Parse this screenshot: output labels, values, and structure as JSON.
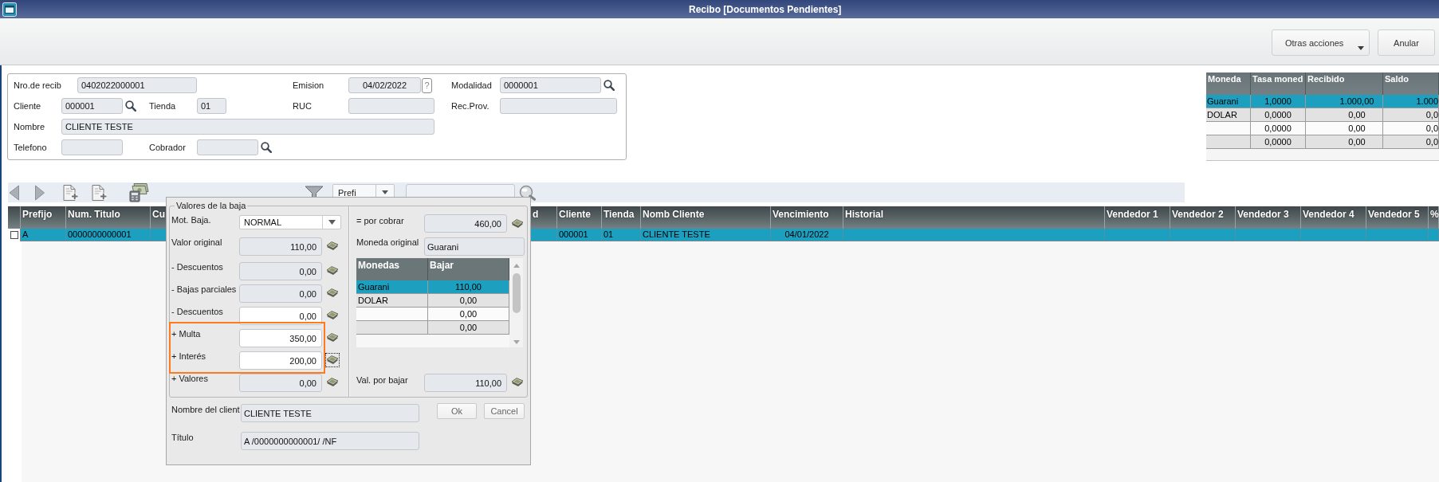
{
  "window": {
    "title": "Recibo [Documentos Pendientes]"
  },
  "toolbar": {
    "buttons": [
      {
        "label": "Otras acciones",
        "kind": "menu"
      },
      {
        "label": "Anular",
        "kind": "plain"
      }
    ]
  },
  "header_form": {
    "rows": [
      [
        {
          "label": "Nro.de recib",
          "value": "0402022000001",
          "kind": "text"
        },
        "",
        {
          "label": "Emision",
          "value": "04/02/2022",
          "kind": "date",
          "help": "?"
        },
        {
          "label": "Modalidad",
          "value": "0000001",
          "kind": "lookup"
        }
      ],
      [
        {
          "label": "Cliente",
          "value": "000001",
          "kind": "lookup"
        },
        {
          "label": "Tienda",
          "value": "01",
          "kind": "text"
        },
        {
          "label": "RUC",
          "kind": "text"
        },
        {
          "label": "Rec.Prov.",
          "kind": "text"
        }
      ],
      [
        {
          "label": "Nombre",
          "value": "CLIENTE TESTE",
          "kind": "text"
        }
      ],
      [
        {
          "label": "Telefono",
          "kind": "text"
        },
        {
          "label": "Cobrador",
          "kind": "lookup"
        }
      ]
    ]
  },
  "currency_table": {
    "columns": [
      "Moneda",
      "Tasa moned",
      "Recibido",
      "Saldo"
    ],
    "rows": [
      {
        "moneda": "Guarani",
        "tasa": "1,0000",
        "recibido": "1.000,00",
        "saldo": "1.000",
        "selected": true
      },
      {
        "moneda": "DOLAR",
        "tasa": "0,0000",
        "recibido": "0,00",
        "saldo": "0,0",
        "selected": false
      },
      {
        "tasa": "0,0000",
        "recibido": "0,00",
        "saldo": "0,0",
        "selected": false
      },
      {
        "tasa": "0,0000",
        "recibido": "0,00",
        "saldo": "0,0",
        "selected": false
      }
    ]
  },
  "grid_toolbar": {
    "filter_field": {
      "value": "Prefi"
    }
  },
  "grid": {
    "columns": [
      "Prefijo",
      "Num. Titulo",
      "Cu",
      "d",
      "Cliente",
      "Tienda",
      "Nomb Cliente",
      "Vencimiento",
      "Historial",
      "Vendedor 1",
      "Vendedor 2",
      "Vendedor 3",
      "Vendedor 4",
      "Vendedor 5",
      "%"
    ],
    "rows": [
      {
        "checked": false,
        "selected": true,
        "cells": [
          "A",
          "0000000000001",
          null,
          null,
          "000001",
          "01",
          "CLIENTE TESTE",
          "04/01/2022",
          null,
          null,
          null,
          null,
          null,
          null,
          null
        ]
      }
    ]
  },
  "dialog": {
    "group_title": "Valores de la baja",
    "left_rows": [
      {
        "label": "Mot. Baja.",
        "value": "NORMAL",
        "kind": "select"
      },
      {
        "label": "Valor original",
        "value": "110,00",
        "kind": "amount",
        "editable": false,
        "highlighted": false,
        "focused": false
      },
      {
        "label": "- Descuentos",
        "value": "0,00",
        "kind": "amount",
        "editable": false,
        "highlighted": false,
        "focused": false
      },
      {
        "label": "- Bajas parciales",
        "value": "0,00",
        "kind": "amount",
        "editable": false,
        "highlighted": false,
        "focused": false
      },
      {
        "label": "- Descuentos",
        "value": "0,00",
        "kind": "amount",
        "editable": true,
        "highlighted": false,
        "focused": false
      },
      {
        "label": "+ Multa",
        "value": "350,00",
        "kind": "amount",
        "editable": true,
        "highlighted": true,
        "focused": false
      },
      {
        "label": "+ Interés",
        "value": "200,00",
        "kind": "amount",
        "editable": true,
        "highlighted": true,
        "focused": true
      },
      {
        "label": "+ Valores",
        "value": "0,00",
        "kind": "amount",
        "editable": false,
        "highlighted": false,
        "focused": false
      }
    ],
    "por_cobrar": {
      "label": "= por cobrar",
      "value": "460,00"
    },
    "moneda_original": {
      "label": "Moneda original",
      "value": "Guarani"
    },
    "currencies": {
      "columns": [
        "Monedas",
        "Bajar"
      ],
      "rows": [
        {
          "moneda": "Guarani",
          "bajar": "110,00",
          "selected": true
        },
        {
          "moneda": "DOLAR",
          "bajar": "0,00",
          "selected": false
        },
        {
          "bajar": "0,00",
          "selected": false
        },
        {
          "bajar": "0,00",
          "selected": false
        }
      ]
    },
    "val_por_bajar": {
      "label": "Val. por bajar",
      "value": "110,00"
    },
    "cliente": {
      "label": "Nombre del client",
      "value": "CLIENTE TESTE"
    },
    "titulo": {
      "label": "Título",
      "value": "A /0000000000001/ /NF"
    },
    "buttons": [
      "Ok",
      "Cancel"
    ]
  }
}
